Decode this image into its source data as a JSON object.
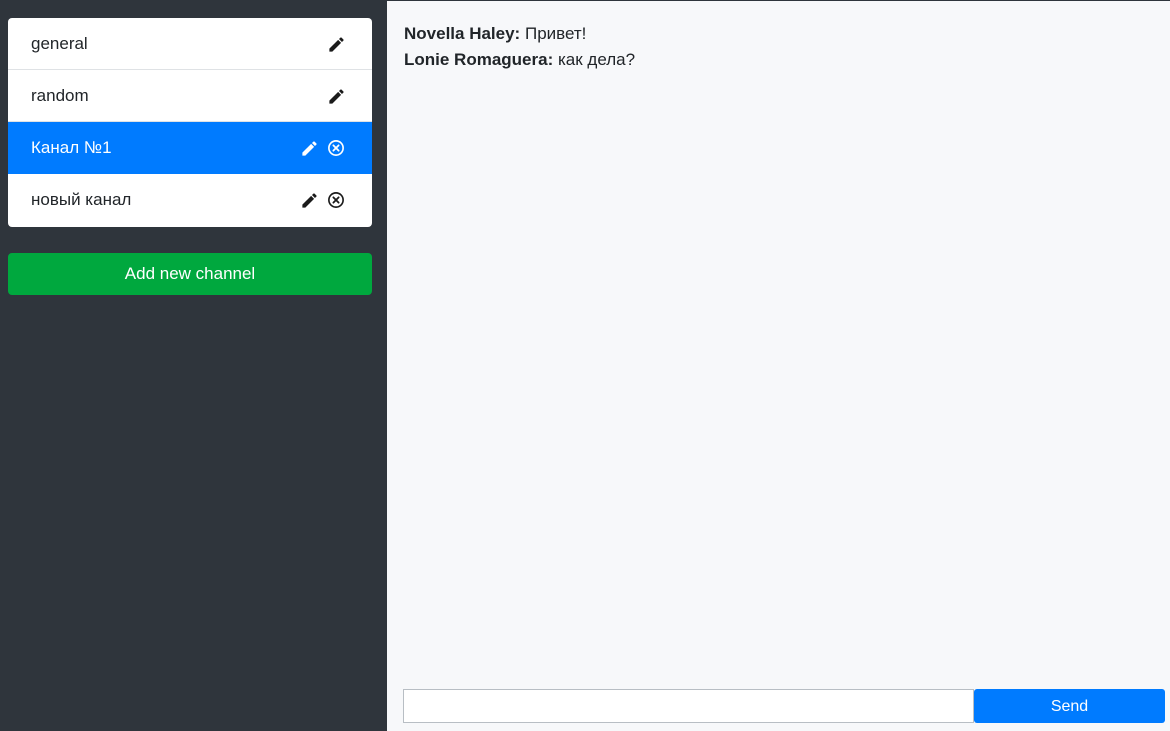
{
  "sidebar": {
    "channels": [
      {
        "name": "general",
        "editable": true,
        "removable": false,
        "active": false
      },
      {
        "name": "random",
        "editable": true,
        "removable": false,
        "active": false
      },
      {
        "name": "Канал №1",
        "editable": true,
        "removable": true,
        "active": true
      },
      {
        "name": "новый канал",
        "editable": true,
        "removable": true,
        "active": false
      }
    ],
    "edit_icon": "pencil-icon",
    "remove_icon": "close-circle-icon",
    "add_button_label": "Add new channel"
  },
  "chat": {
    "messages": [
      {
        "author": "Novella Haley:",
        "text": "Привет!"
      },
      {
        "author": "Lonie Romaguera:",
        "text": "как дела?"
      }
    ],
    "input_value": "",
    "input_placeholder": "",
    "send_label": "Send"
  },
  "colors": {
    "sidebar_bg": "#2f353c",
    "active_channel": "#007bff",
    "add_button": "#00a83e",
    "send_button": "#007bff",
    "main_bg": "#f7f8fa"
  }
}
